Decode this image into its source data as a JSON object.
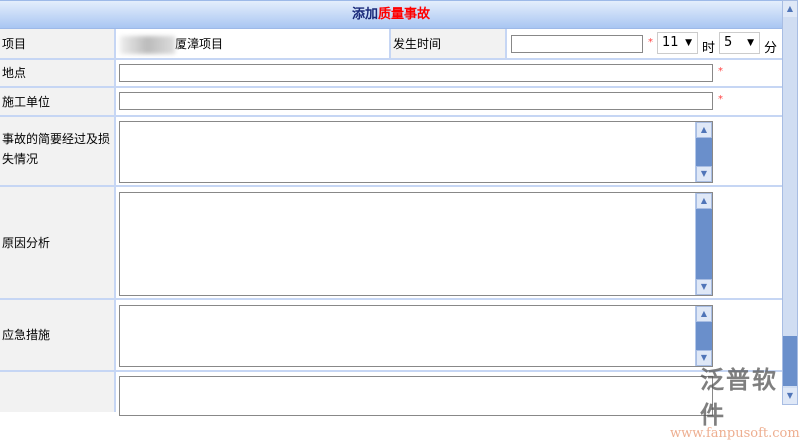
{
  "title": {
    "prefix": "添加",
    "highlight": "质量事故"
  },
  "fields": {
    "project": {
      "label": "项目",
      "value": "厦漳项目"
    },
    "time": {
      "label": "发生时间",
      "date_value": "",
      "hour": "11",
      "hour_unit": "时",
      "minute": "5",
      "minute_unit": "分"
    },
    "location": {
      "label": "地点",
      "value": ""
    },
    "unit": {
      "label": "施工单位",
      "value": ""
    },
    "summary": {
      "label": "事故的简要经过及损失情况",
      "value": ""
    },
    "cause": {
      "label": "原因分析",
      "value": ""
    },
    "emergency": {
      "label": "应急措施",
      "value": ""
    }
  },
  "required_mark": "*",
  "watermark": {
    "name": "泛普软件",
    "url": "www.fanpusoft.com"
  }
}
